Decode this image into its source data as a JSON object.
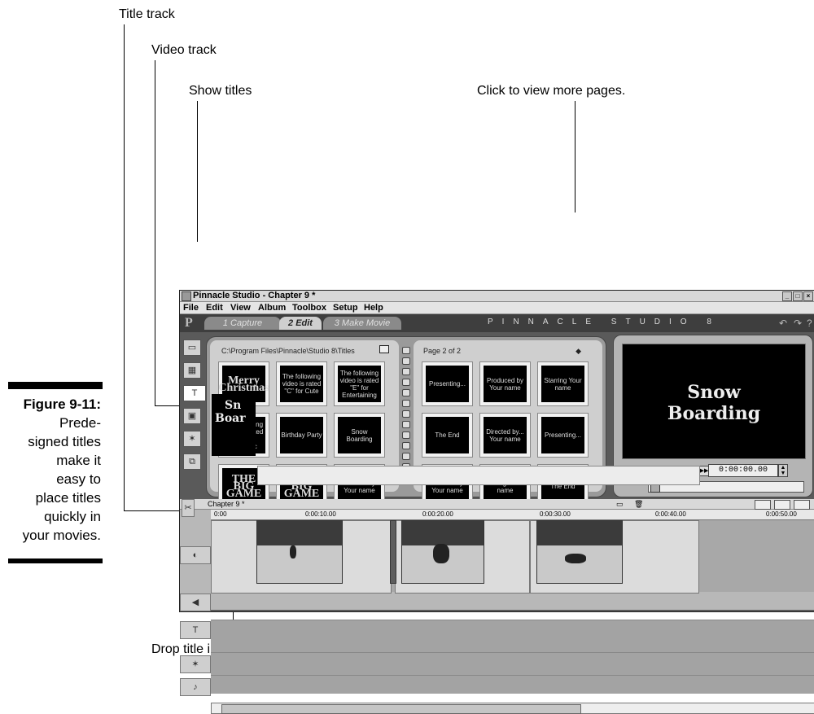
{
  "callouts": {
    "title_track": "Title track",
    "video_track": "Video track",
    "show_titles": "Show titles",
    "more_pages": "Click to view more pages.",
    "drop_title": "Drop title in timeline."
  },
  "caption": {
    "label": "Figure 9-11:",
    "line1": "Prede-",
    "line2": "signed titles",
    "line3": "make it",
    "line4": "easy to",
    "line5": "place titles",
    "line6": "quickly in",
    "line7": "your movies."
  },
  "window": {
    "title": "Pinnacle Studio - Chapter 9 *",
    "menu": [
      "File",
      "Edit",
      "View",
      "Album",
      "Toolbox",
      "Setup",
      "Help"
    ],
    "tabs": {
      "capture": "1 Capture",
      "edit": "2 Edit",
      "make": "3 Make Movie"
    },
    "brand": "PINNACLE STUDIO 8"
  },
  "album": {
    "path": "C:\\Program Files\\Pinnacle\\Studio 8\\Titles",
    "page_label": "Page 2 of 2",
    "left_thumbs": [
      {
        "text": "Merry Christmas",
        "big": true
      },
      {
        "text": "The following video is rated \"C\" for Cute",
        "big": false
      },
      {
        "text": "The following video is rated \"E\" for Entertaining",
        "big": false
      },
      {
        "text": "The following video is rated \"F\" for Fantastic",
        "big": false
      },
      {
        "text": "Birthday Party",
        "big": false
      },
      {
        "text": "Snow Boarding",
        "big": false
      },
      {
        "text": "THE BIG GAME",
        "big": true
      },
      {
        "text": "THE BIG GAME",
        "big": true
      },
      {
        "text": "Created by Your name",
        "big": false
      }
    ],
    "right_thumbs": [
      {
        "text": "Presenting...",
        "big": false
      },
      {
        "text": "Produced by Your name",
        "big": false
      },
      {
        "text": "Starring Your name",
        "big": false
      },
      {
        "text": "The End",
        "big": false
      },
      {
        "text": "Directed by... Your name",
        "big": false
      },
      {
        "text": "Presenting...",
        "big": false
      },
      {
        "text": "Produced by... Your name",
        "big": false
      },
      {
        "text": "Starring... Your name",
        "big": false
      },
      {
        "text": "The End",
        "big": false
      }
    ]
  },
  "player": {
    "screen_line1": "Snow",
    "screen_line2": "Boarding",
    "timecode": "0:00:00.00"
  },
  "timeline": {
    "name": "Chapter 9 *",
    "ruler": [
      "0:00",
      "0:00:10.00",
      "0:00:20.00",
      "0:00:30.00",
      "0:00:40.00",
      "0:00:50.00"
    ],
    "title_clip_line1": "Sn",
    "title_clip_line2": "Boar"
  }
}
